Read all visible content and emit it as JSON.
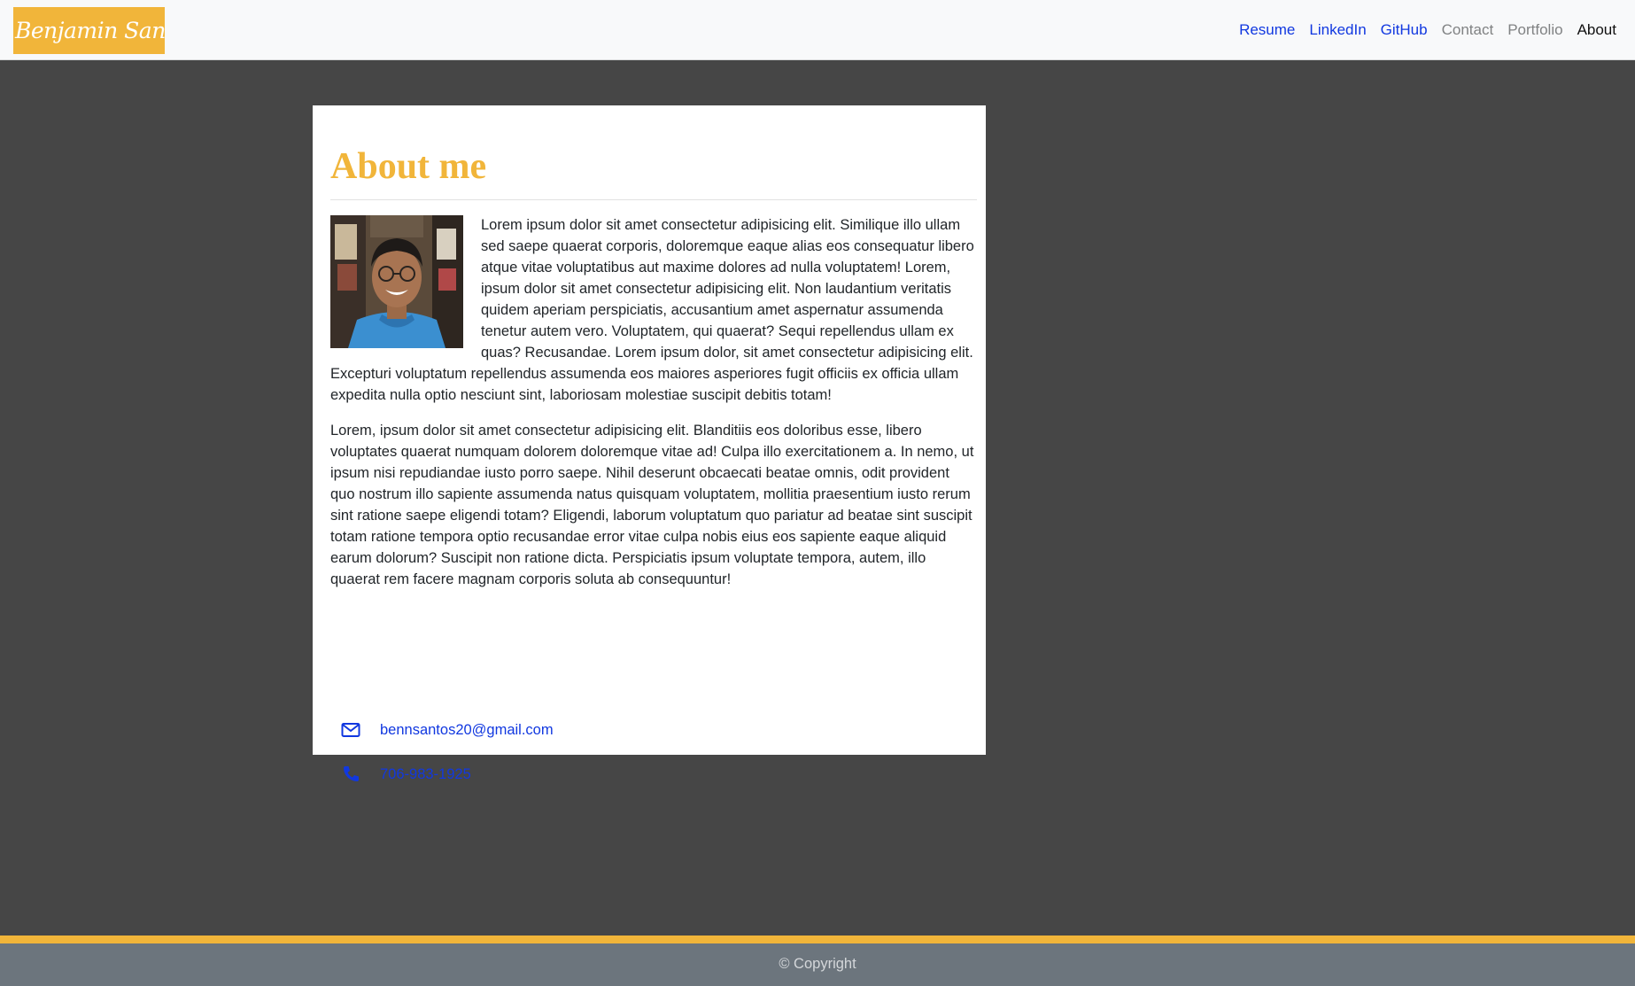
{
  "navbar": {
    "brand": "Benjamin Santos",
    "links": [
      {
        "label": "Resume"
      },
      {
        "label": "LinkedIn"
      },
      {
        "label": "GitHub"
      },
      {
        "label": "Contact"
      },
      {
        "label": "Portfolio"
      },
      {
        "label": "About"
      }
    ]
  },
  "about": {
    "title": "About me",
    "paragraph1": "Lorem ipsum dolor sit amet consectetur adipisicing elit. Similique illo ullam sed saepe quaerat corporis, doloremque eaque alias eos consequatur libero atque vitae voluptatibus aut maxime dolores ad nulla voluptatem! Lorem, ipsum dolor sit amet consectetur adipisicing elit. Non laudantium veritatis quidem aperiam perspiciatis, accusantium amet aspernatur assumenda tenetur autem vero. Voluptatem, qui quaerat? Sequi repellendus ullam ex quas? Recusandae. Lorem ipsum dolor, sit amet consectetur adipisicing elit. Excepturi voluptatum repellendus assumenda eos maiores asperiores fugit officiis ex officia ullam expedita nulla optio nesciunt sint, laboriosam molestiae suscipit debitis totam!",
    "paragraph2": "Lorem, ipsum dolor sit amet consectetur adipisicing elit. Blanditiis eos doloribus esse, libero voluptates quaerat numquam dolorem doloremque vitae ad! Culpa illo exercitationem a. In nemo, ut ipsum nisi repudiandae iusto porro saepe. Nihil deserunt obcaecati beatae omnis, odit provident quo nostrum illo sapiente assumenda natus quisquam voluptatem, mollitia praesentium iusto rerum sint ratione saepe eligendi totam? Eligendi, laborum voluptatum quo pariatur ad beatae sint suscipit totam ratione tempora optio recusandae error vitae culpa nobis eius eos sapiente eaque aliquid earum dolorum? Suscipit non ratione dicta. Perspiciatis ipsum voluptate tempora, autem, illo quaerat rem facere magnam corporis soluta ab consequuntur!",
    "email": "bennsantos20@gmail.com",
    "email_icon": "envelope-icon",
    "phone": "706-983-1925",
    "phone_icon": "phone-icon"
  },
  "footer": {
    "text": "© Copyright"
  },
  "colors": {
    "accent": "#f1b53a",
    "link": "#1138e0",
    "background": "#464646",
    "footer": "#6c757d"
  }
}
